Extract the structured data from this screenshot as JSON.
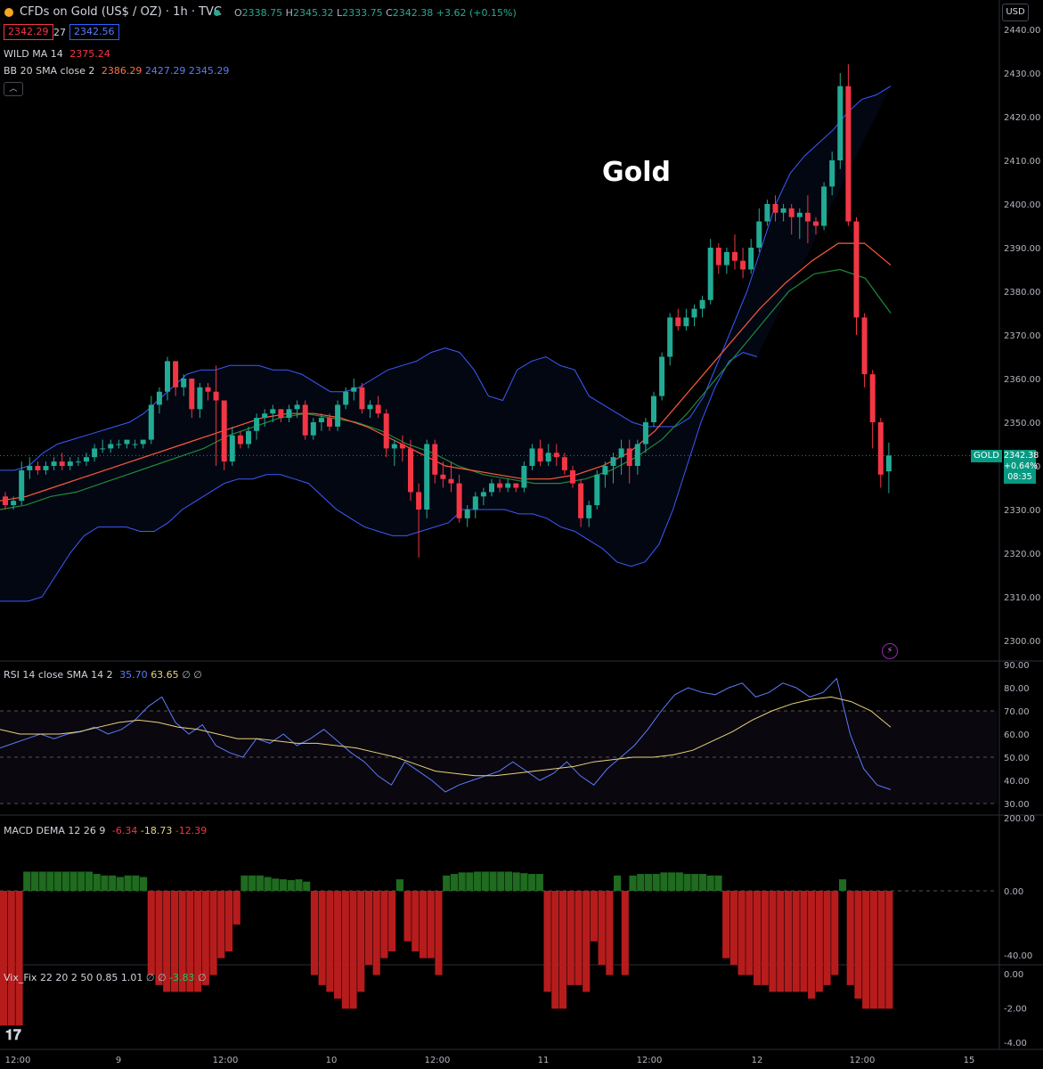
{
  "header": {
    "symbol_title": "CFDs on Gold (US$ / OZ) · 1h · TVC",
    "ohlc": {
      "o_label": "O",
      "o": "2338.75",
      "h_label": "H",
      "h": "2345.32",
      "l_label": "L",
      "l": "2333.75",
      "c_label": "C",
      "c": "2342.38",
      "change": "+3.62 (+0.15%)"
    },
    "bid": "2342.29",
    "spread": "27",
    "ask": "2342.56",
    "wild_ma": {
      "label": "WILD MA 14",
      "value": "2375.24"
    },
    "bb": {
      "label": "BB 20 SMA close 2",
      "basis": "2386.29",
      "upper": "2427.29",
      "lower": "2345.29"
    },
    "collapse_icon": "chevron-up-icon",
    "currency": "USD"
  },
  "annotation": "Gold",
  "last_price": {
    "symbol": "GOLD",
    "price": "2342.38",
    "change_pct": "+0.64%",
    "countdown": "08:35"
  },
  "rsi": {
    "label": "RSI 14 close SMA 14 2",
    "value": "35.70",
    "sma": "63.65",
    "extra": "∅ ∅"
  },
  "macd": {
    "label": "MACD DEMA 12 26 9",
    "hist": "-6.34",
    "macd": "-18.73",
    "signal": "-12.39"
  },
  "vix": {
    "label": "Vix_Fix 22 20 2 50 0.85 1.01",
    "extra": "∅ ∅",
    "value": "-3.83",
    "extra2": "∅"
  },
  "colors": {
    "up": "#22ab94",
    "down": "#f23645",
    "bb": "#3d5afe",
    "wild": "#ff5a3c",
    "rsi": "#5b7cfa",
    "rsi_sma": "#e8d37a",
    "green_hist": "#1f6b1f",
    "red_hist": "#b71c1c"
  },
  "chart_data": [
    {
      "type": "candlestick",
      "ylim": [
        2300,
        2440
      ],
      "y_ticks": [
        "2440.00",
        "2430.00",
        "2420.00",
        "2410.00",
        "2400.00",
        "2390.00",
        "2380.00",
        "2370.00",
        "2360.00",
        "2350.00",
        "2340.00",
        "2330.00",
        "2320.00",
        "2310.00",
        "2300.00"
      ],
      "x_ticks": [
        "12:00",
        "9",
        "12:00",
        "10",
        "12:00",
        "11",
        "12:00",
        "12",
        "12:00",
        "15"
      ],
      "candles": [
        [
          2333,
          2334,
          2330,
          2331
        ],
        [
          2331,
          2333,
          2330,
          2332
        ],
        [
          2332,
          2341,
          2331,
          2339
        ],
        [
          2339,
          2342,
          2337,
          2340
        ],
        [
          2340,
          2341,
          2338,
          2339
        ],
        [
          2339,
          2341,
          2338,
          2340
        ],
        [
          2340,
          2342,
          2339,
          2341
        ],
        [
          2341,
          2343,
          2339,
          2340
        ],
        [
          2340,
          2342,
          2339,
          2341
        ],
        [
          2341,
          2342,
          2340,
          2341
        ],
        [
          2341,
          2343,
          2340,
          2342
        ],
        [
          2342,
          2345,
          2341,
          2344
        ],
        [
          2344,
          2346,
          2343,
          2344
        ],
        [
          2344,
          2346,
          2343,
          2345
        ],
        [
          2345,
          2346,
          2344,
          2345
        ],
        [
          2345,
          2346,
          2344,
          2346
        ],
        [
          2345,
          2346,
          2344,
          2345
        ],
        [
          2345,
          2346,
          2344,
          2346
        ],
        [
          2346,
          2356,
          2345,
          2354
        ],
        [
          2354,
          2358,
          2352,
          2357
        ],
        [
          2357,
          2365,
          2355,
          2364
        ],
        [
          2364,
          2364,
          2356,
          2358
        ],
        [
          2358,
          2361,
          2356,
          2360
        ],
        [
          2360,
          2360,
          2351,
          2353
        ],
        [
          2353,
          2359,
          2351,
          2358
        ],
        [
          2358,
          2359,
          2355,
          2357
        ],
        [
          2357,
          2363,
          2340,
          2355
        ],
        [
          2355,
          2355,
          2339,
          2341
        ],
        [
          2341,
          2349,
          2340,
          2347
        ],
        [
          2347,
          2348,
          2344,
          2345
        ],
        [
          2345,
          2349,
          2344,
          2348
        ],
        [
          2348,
          2352,
          2346,
          2351
        ],
        [
          2351,
          2353,
          2349,
          2352
        ],
        [
          2352,
          2354,
          2350,
          2353
        ],
        [
          2353,
          2353,
          2350,
          2351
        ],
        [
          2351,
          2354,
          2350,
          2353
        ],
        [
          2353,
          2355,
          2351,
          2354
        ],
        [
          2354,
          2355,
          2346,
          2347
        ],
        [
          2347,
          2351,
          2346,
          2350
        ],
        [
          2350,
          2352,
          2348,
          2351
        ],
        [
          2351,
          2352,
          2348,
          2349
        ],
        [
          2349,
          2355,
          2348,
          2354
        ],
        [
          2354,
          2358,
          2353,
          2357
        ],
        [
          2357,
          2360,
          2355,
          2358
        ],
        [
          2358,
          2359,
          2352,
          2353
        ],
        [
          2353,
          2355,
          2351,
          2354
        ],
        [
          2354,
          2356,
          2351,
          2352
        ],
        [
          2352,
          2353,
          2342,
          2344
        ],
        [
          2344,
          2346,
          2340,
          2345
        ],
        [
          2345,
          2347,
          2341,
          2344
        ],
        [
          2344,
          2346,
          2332,
          2334
        ],
        [
          2334,
          2336,
          2319,
          2330
        ],
        [
          2330,
          2346,
          2328,
          2345
        ],
        [
          2345,
          2346,
          2336,
          2338
        ],
        [
          2338,
          2341,
          2335,
          2337
        ],
        [
          2337,
          2341,
          2334,
          2336
        ],
        [
          2336,
          2338,
          2327,
          2328
        ],
        [
          2328,
          2331,
          2326,
          2330
        ],
        [
          2330,
          2334,
          2328,
          2333
        ],
        [
          2333,
          2335,
          2331,
          2334
        ],
        [
          2334,
          2337,
          2333,
          2336
        ],
        [
          2336,
          2337,
          2334,
          2335
        ],
        [
          2335,
          2337,
          2334,
          2336
        ],
        [
          2336,
          2336,
          2334,
          2335
        ],
        [
          2335,
          2341,
          2334,
          2340
        ],
        [
          2340,
          2345,
          2339,
          2344
        ],
        [
          2344,
          2346,
          2340,
          2341
        ],
        [
          2341,
          2345,
          2340,
          2343
        ],
        [
          2343,
          2345,
          2340,
          2342
        ],
        [
          2342,
          2343,
          2338,
          2339
        ],
        [
          2339,
          2340,
          2335,
          2336
        ],
        [
          2336,
          2337,
          2326,
          2328
        ],
        [
          2328,
          2332,
          2326,
          2331
        ],
        [
          2331,
          2339,
          2330,
          2338
        ],
        [
          2338,
          2341,
          2335,
          2340
        ],
        [
          2340,
          2343,
          2336,
          2342
        ],
        [
          2342,
          2346,
          2338,
          2344
        ],
        [
          2344,
          2346,
          2336,
          2340
        ],
        [
          2340,
          2346,
          2338,
          2345
        ],
        [
          2345,
          2351,
          2343,
          2350
        ],
        [
          2350,
          2357,
          2349,
          2356
        ],
        [
          2356,
          2366,
          2355,
          2365
        ],
        [
          2365,
          2375,
          2363,
          2374
        ],
        [
          2374,
          2376,
          2371,
          2372
        ],
        [
          2372,
          2376,
          2371,
          2374
        ],
        [
          2374,
          2377,
          2372,
          2376
        ],
        [
          2376,
          2379,
          2374,
          2378
        ],
        [
          2378,
          2392,
          2377,
          2390
        ],
        [
          2390,
          2391,
          2384,
          2386
        ],
        [
          2386,
          2390,
          2384,
          2389
        ],
        [
          2389,
          2393,
          2385,
          2387
        ],
        [
          2387,
          2390,
          2383,
          2385
        ],
        [
          2385,
          2392,
          2384,
          2390
        ],
        [
          2390,
          2399,
          2389,
          2396
        ],
        [
          2396,
          2401,
          2395,
          2400
        ],
        [
          2400,
          2402,
          2396,
          2398
        ],
        [
          2398,
          2400,
          2396,
          2399
        ],
        [
          2399,
          2400,
          2393,
          2397
        ],
        [
          2397,
          2399,
          2392,
          2398
        ],
        [
          2398,
          2402,
          2391,
          2396
        ],
        [
          2396,
          2397,
          2393,
          2395
        ],
        [
          2395,
          2405,
          2394,
          2404
        ],
        [
          2404,
          2412,
          2402,
          2410
        ],
        [
          2410,
          2430,
          2408,
          2427
        ],
        [
          2427,
          2432,
          2395,
          2396
        ],
        [
          2396,
          2397,
          2370,
          2374
        ],
        [
          2374,
          2375,
          2358,
          2361
        ],
        [
          2361,
          2362,
          2344,
          2350
        ],
        [
          2350,
          2351,
          2335,
          2338
        ],
        [
          2338.75,
          2345.32,
          2333.75,
          2342.38
        ]
      ],
      "bb_upper": [
        2339,
        2339,
        2340,
        2343,
        2345,
        2346,
        2347,
        2348,
        2349,
        2350,
        2352,
        2355,
        2358,
        2361,
        2362,
        2362,
        2363,
        2363,
        2363,
        2362,
        2362,
        2361,
        2359,
        2357,
        2357,
        2358,
        2360,
        2362,
        2363,
        2364,
        2366,
        2367,
        2366,
        2362,
        2356,
        2355,
        2362,
        2364,
        2365,
        2363,
        2362,
        2356,
        2354,
        2352,
        2350,
        2349,
        2349,
        2349,
        2351,
        2356,
        2364,
        2372,
        2380,
        2390,
        2400,
        2407,
        2411,
        2414,
        2417,
        2421,
        2424,
        2425,
        2427
      ],
      "bb_lower": [
        2309,
        2309,
        2309,
        2310,
        2315,
        2320,
        2324,
        2326,
        2326,
        2326,
        2325,
        2325,
        2327,
        2330,
        2332,
        2334,
        2336,
        2337,
        2337,
        2338,
        2338,
        2337,
        2336,
        2333,
        2330,
        2328,
        2326,
        2325,
        2324,
        2324,
        2325,
        2326,
        2327,
        2330,
        2330,
        2330,
        2330,
        2329,
        2329,
        2328,
        2326,
        2325,
        2323,
        2321,
        2318,
        2317,
        2318,
        2322,
        2330,
        2340,
        2350,
        2358,
        2364,
        2366,
        2365
      ],
      "bb_basis": [
        2330,
        2331,
        2333,
        2334,
        2336,
        2338,
        2340,
        2342,
        2344,
        2347,
        2349,
        2351,
        2352,
        2351,
        2350,
        2348,
        2345,
        2343,
        2340,
        2338,
        2337,
        2336,
        2336,
        2337,
        2339,
        2342,
        2346,
        2352,
        2359,
        2366,
        2373,
        2380,
        2384,
        2385,
        2383,
        2375
      ],
      "wild_ma": [
        2332,
        2333,
        2335,
        2337,
        2339,
        2341,
        2343,
        2345,
        2347,
        2349,
        2351,
        2352,
        2352,
        2351,
        2349,
        2346,
        2343,
        2340,
        2339,
        2338,
        2337,
        2337,
        2338,
        2340,
        2343,
        2348,
        2355,
        2362,
        2369,
        2376,
        2382,
        2387,
        2391,
        2391,
        2386
      ]
    },
    {
      "type": "line",
      "title": "RSI 14 close SMA 14 2",
      "ylim": [
        25,
        92
      ],
      "y_ticks": [
        "90.00",
        "80.00",
        "70.00",
        "60.00",
        "50.00",
        "40.00",
        "30.00"
      ],
      "series": [
        {
          "values": [
            54,
            56,
            58,
            60,
            58,
            60,
            61,
            63,
            60,
            62,
            66,
            72,
            76,
            65,
            60,
            64,
            55,
            52,
            50,
            58,
            56,
            60,
            55,
            58,
            62,
            57,
            52,
            48,
            42,
            38,
            48,
            44,
            40,
            35,
            38,
            40,
            42,
            44,
            48,
            44,
            40,
            43,
            48,
            42,
            38,
            45,
            50,
            55,
            62,
            70,
            77,
            80,
            78,
            77,
            80,
            82,
            76,
            78,
            82,
            80,
            76,
            78,
            84,
            60,
            45,
            38,
            36
          ]
        },
        {
          "values": [
            62,
            60,
            60,
            60,
            61,
            63,
            65,
            66,
            65,
            63,
            62,
            60,
            58,
            58,
            57,
            56,
            56,
            55,
            54,
            52,
            50,
            47,
            44,
            43,
            42,
            42,
            43,
            44,
            45,
            46,
            48,
            49,
            50,
            50,
            51,
            53,
            57,
            61,
            66,
            70,
            73,
            75,
            76,
            74,
            70,
            63
          ]
        }
      ]
    },
    {
      "type": "bar",
      "title": "MACD DEMA 12 26 9",
      "ylim": [
        -45,
        200
      ],
      "y_ticks": [
        "200.00",
        "0.00",
        "-40.00"
      ],
      "values": [
        -40,
        -40,
        -40,
        25,
        25,
        25,
        25,
        25,
        25,
        25,
        25,
        25,
        22,
        20,
        20,
        18,
        20,
        20,
        18,
        -25,
        -28,
        -30,
        -30,
        -30,
        -30,
        -30,
        -28,
        -25,
        -20,
        -18,
        -10,
        20,
        20,
        20,
        18,
        16,
        15,
        14,
        15,
        12,
        -25,
        -28,
        -30,
        -32,
        -35,
        -35,
        -30,
        -22,
        -25,
        -20,
        -18,
        15,
        -15,
        -18,
        -20,
        -20,
        -25,
        20,
        22,
        24,
        24,
        25,
        25,
        25,
        25,
        25,
        24,
        23,
        22,
        22,
        -30,
        -35,
        -35,
        -28,
        -28,
        -30,
        -15,
        -22,
        -25,
        20,
        -25,
        20,
        22,
        22,
        22,
        24,
        24,
        24,
        22,
        22,
        22,
        20,
        20,
        -20,
        -22,
        -25,
        -25,
        -28,
        -28,
        -30,
        -30,
        -30,
        -30,
        -30,
        -32,
        -30,
        -28,
        -25,
        15,
        -28,
        -32,
        -35,
        -35,
        -35,
        -35
      ]
    },
    {
      "type": "bar",
      "title": "Vix_Fix 22 20 2 50 0.85 1.01",
      "ylim": [
        -4.2,
        0.2
      ],
      "y_ticks": [
        "0.00",
        "-2.00",
        "-4.00"
      ]
    }
  ],
  "x_axis_labels": [
    "12:00",
    "9",
    "12:00",
    "10",
    "12:00",
    "11",
    "12:00",
    "12",
    "12:00",
    "15"
  ]
}
